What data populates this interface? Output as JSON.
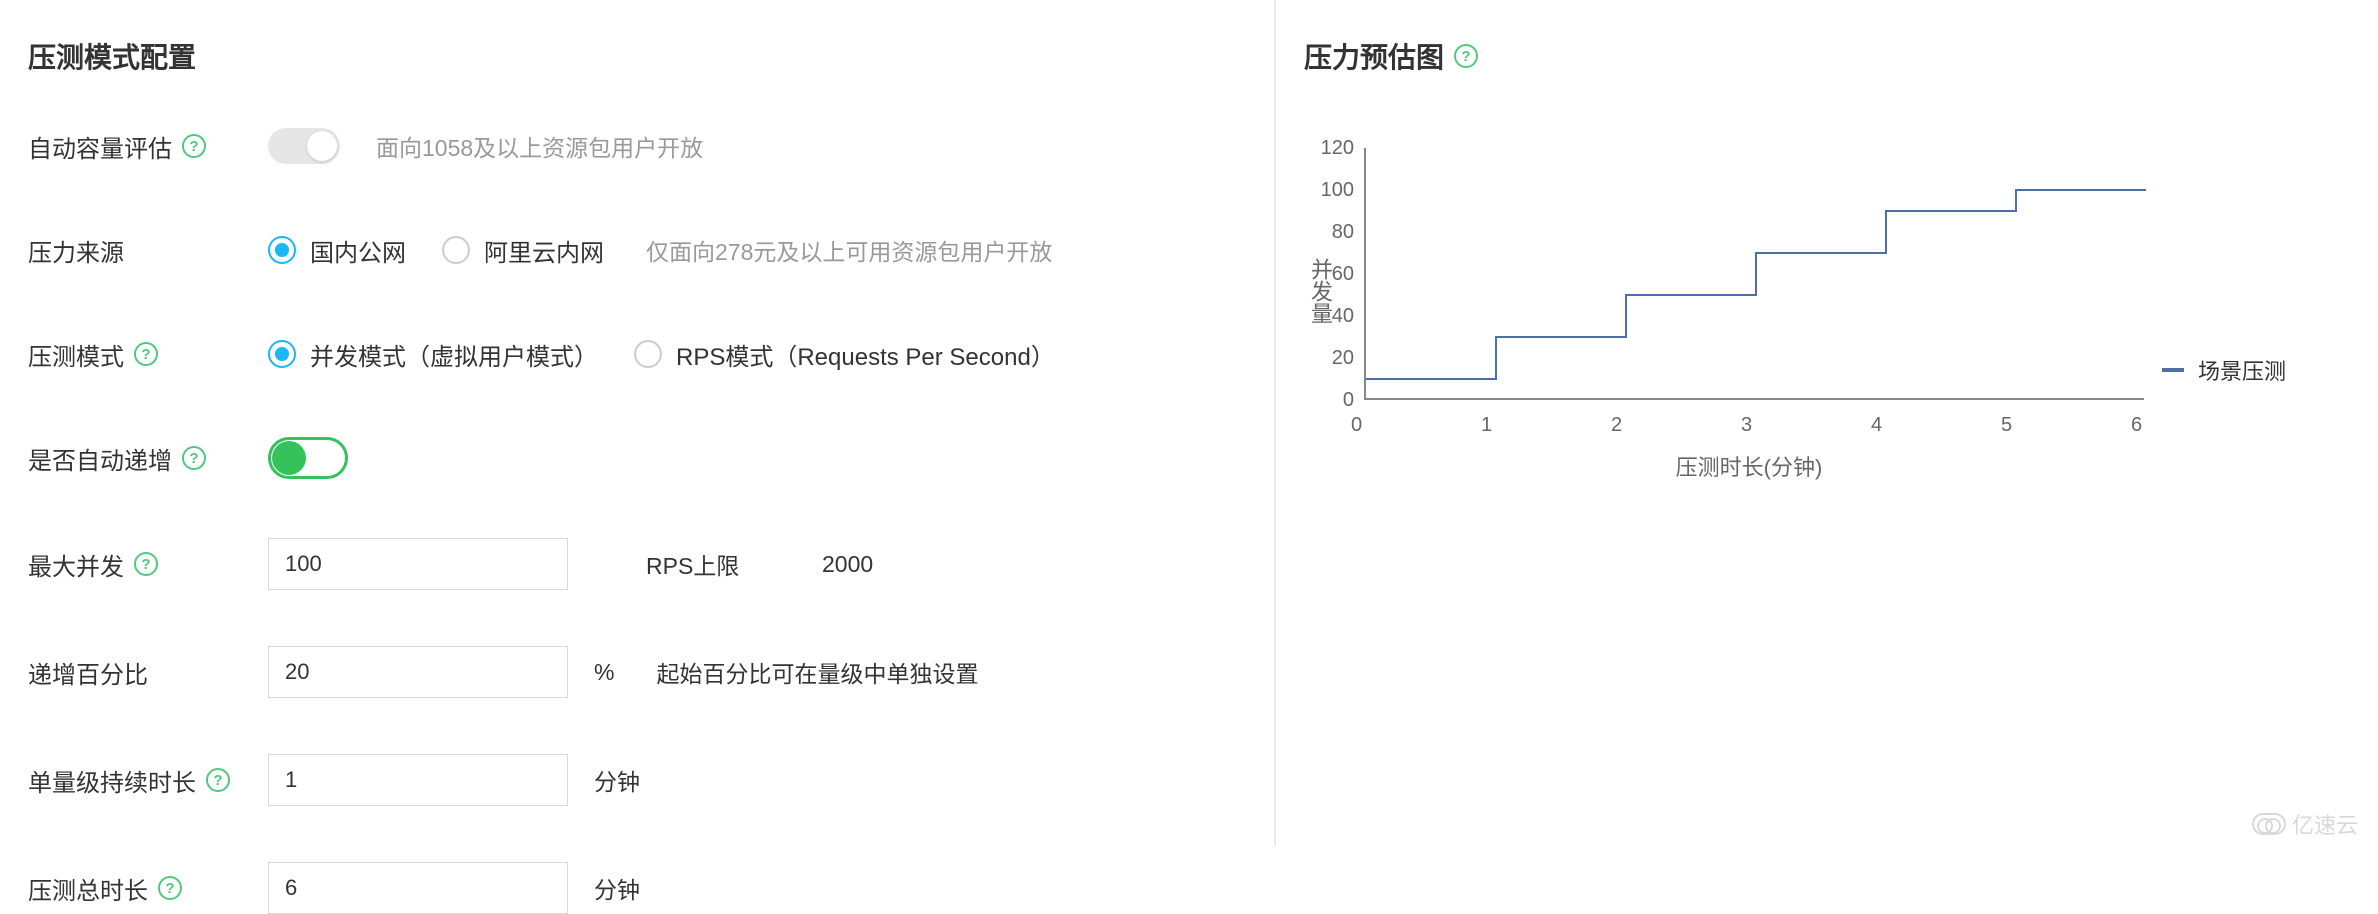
{
  "left": {
    "title": "压测模式配置",
    "auto_capacity": {
      "label": "自动容量评估",
      "switch_on": false,
      "hint": "面向1058及以上资源包用户开放"
    },
    "source": {
      "label": "压力来源",
      "options": [
        {
          "label": "国内公网",
          "selected": true
        },
        {
          "label": "阿里云内网",
          "selected": false
        }
      ],
      "hint": "仅面向278元及以上可用资源包用户开放"
    },
    "mode": {
      "label": "压测模式",
      "options": [
        {
          "label": "并发模式（虚拟用户模式）",
          "selected": true
        },
        {
          "label": "RPS模式（Requests Per Second）",
          "selected": false
        }
      ]
    },
    "auto_increment": {
      "label": "是否自动递增",
      "switch_on": true
    },
    "max_concurrency": {
      "label": "最大并发",
      "value": "100",
      "rps_label": "RPS上限",
      "rps_value": "2000"
    },
    "increment_pct": {
      "label": "递增百分比",
      "value": "20",
      "unit": "%",
      "hint": "起始百分比可在量级中单独设置"
    },
    "step_duration": {
      "label": "单量级持续时长",
      "value": "1",
      "unit": "分钟"
    },
    "total_duration": {
      "label": "压测总时长",
      "value": "6",
      "unit": "分钟"
    }
  },
  "right": {
    "title": "压力预估图",
    "y_axis_label": "并发量",
    "x_axis_label": "压测时长(分钟)",
    "legend": "场景压测"
  },
  "chart_data": {
    "type": "line",
    "title": "压力预估图",
    "xlabel": "压测时长(分钟)",
    "ylabel": "并发量",
    "x_ticks": [
      0,
      1,
      2,
      3,
      4,
      5,
      6
    ],
    "y_ticks": [
      0,
      20,
      40,
      60,
      80,
      100,
      120
    ],
    "xlim": [
      0,
      6
    ],
    "ylim": [
      0,
      120
    ],
    "series": [
      {
        "name": "场景压测",
        "step": true,
        "x": [
          0,
          1,
          1,
          2,
          2,
          3,
          3,
          4,
          4,
          5,
          5,
          6
        ],
        "y": [
          10,
          10,
          30,
          30,
          50,
          50,
          70,
          70,
          90,
          90,
          100,
          100
        ]
      }
    ]
  },
  "watermark": "亿速云"
}
